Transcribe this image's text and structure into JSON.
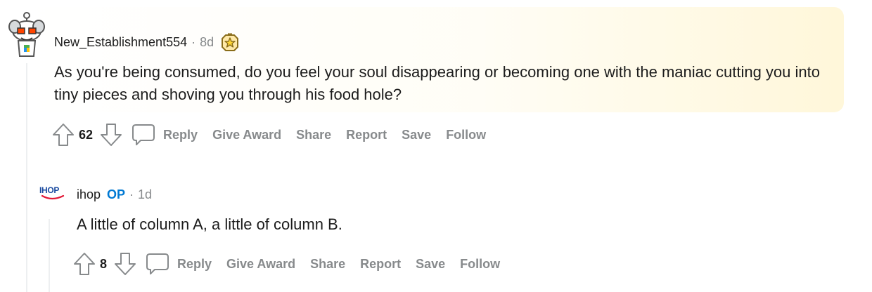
{
  "comments": [
    {
      "username": "New_Establishment554",
      "separator": "·",
      "time": "8d",
      "body": "As you're being consumed, do you feel your soul disappearing or becoming one with the maniac cutting you into tiny pieces and shoving you through his food hole?",
      "score": "62",
      "actions": {
        "reply": "Reply",
        "give_award": "Give Award",
        "share": "Share",
        "report": "Report",
        "save": "Save",
        "follow": "Follow"
      },
      "icons": {
        "avatar": "snoo-avatar",
        "award": "star-award-icon"
      }
    },
    {
      "username": "ihop",
      "op_badge": "OP",
      "separator": "·",
      "time": "1d",
      "body": "A little of column A, a little of column B.",
      "score": "8",
      "avatar_text": "IHOP",
      "actions": {
        "reply": "Reply",
        "give_award": "Give Award",
        "share": "Share",
        "report": "Report",
        "save": "Save",
        "follow": "Follow"
      }
    }
  ],
  "colors": {
    "op_blue": "#0079d3",
    "muted": "#878a8c",
    "ihop_blue": "#1a4ba0",
    "ihop_red": "#e21836"
  }
}
